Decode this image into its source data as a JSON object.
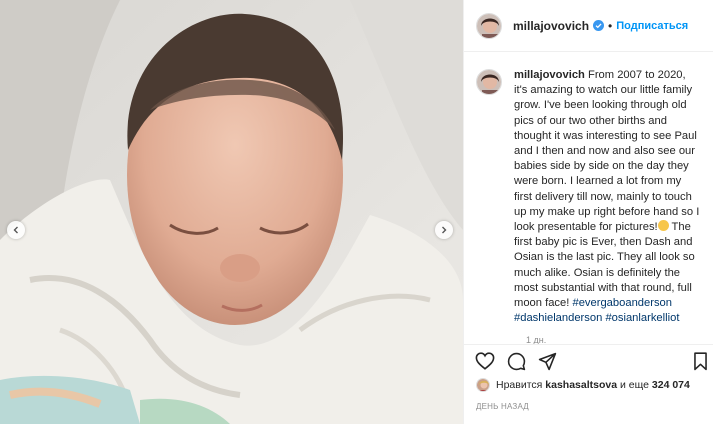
{
  "post": {
    "username": "millajovovich",
    "follow_label": "Подписаться",
    "separator": "•"
  },
  "caption": {
    "username": "millajovovich",
    "part1": "From 2007 to 2020, it's amazing to watch our little family grow. I've been looking through old pics of our two other births and thought it was interesting to see Paul and I then and now and also see our babies side by side on the day they were born. I learned a lot from my first delivery till now, mainly to touch up my make up right before hand so I look presentable for pictures!",
    "part2": " The first baby pic is Ever, then Dash and Osian is the last pic. They all look so much alike. Osian is definitely the most substantial with that round, full moon face! ",
    "hashtags": [
      "#evergaboanderson",
      "#dashielanderson",
      "#osianlarkelliot"
    ],
    "emoji": "smiling-face-with-tears-emoji",
    "age": "1 дн."
  },
  "likes": {
    "prefix": "Нравится",
    "user": "kashasaltsova",
    "middle": "и еще",
    "count": "324 074"
  },
  "timestamp": "ДЕНЬ НАЗАД",
  "icons": {
    "prev": "chevron-left-icon",
    "next": "chevron-right-icon",
    "like": "heart-icon",
    "comment": "comment-icon",
    "share": "share-icon",
    "save": "bookmark-icon",
    "verified": "verified-badge-icon"
  },
  "colors": {
    "link": "#0095f6",
    "hashtag": "#00376b",
    "text": "#262626",
    "muted": "#8e8e8e",
    "verified": "#3897f0"
  }
}
